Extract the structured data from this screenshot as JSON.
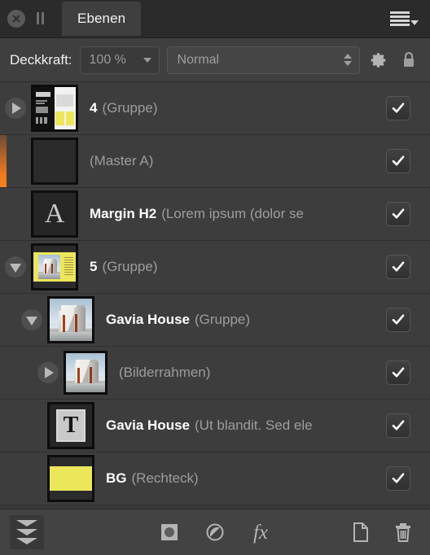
{
  "window": {
    "tab_label": "Ebenen",
    "close_icon": "close-circle-icon",
    "grip_icon": "pause-grip-icon",
    "panel_menu_icon": "hamburger-menu-icon"
  },
  "options": {
    "opacity_label": "Deckkraft:",
    "opacity_value": "100 %",
    "blend_mode_value": "Normal",
    "blend_mode_placeholder": "Normal",
    "settings_icon": "gear-icon",
    "lock_icon": "lock-icon"
  },
  "layers": [
    {
      "name": "4",
      "type": "(Gruppe)",
      "indent": 0,
      "twisty": "collapsed",
      "thumb": "spread",
      "visible": true,
      "master_marker": false
    },
    {
      "name": "",
      "type": "(Master A)",
      "indent": 0,
      "twisty": "none",
      "thumb": "dark",
      "visible": true,
      "master_marker": true
    },
    {
      "name": "Margin H2",
      "type": "(Lorem ipsum (dolor se",
      "indent": 0,
      "twisty": "none",
      "thumb": "glyph-A",
      "visible": true,
      "master_marker": false
    },
    {
      "name": "5",
      "type": "(Gruppe)",
      "indent": 0,
      "twisty": "expanded",
      "thumb": "yellow-page",
      "visible": true,
      "master_marker": false
    },
    {
      "name": "Gavia House",
      "type": "(Gruppe)",
      "indent": 1,
      "twisty": "expanded",
      "thumb": "building",
      "visible": true,
      "master_marker": false
    },
    {
      "name": "",
      "type": "(Bilderrahmen)",
      "indent": 2,
      "twisty": "collapsed",
      "thumb": "building",
      "visible": true,
      "master_marker": false
    },
    {
      "name": "Gavia House",
      "type": "(Ut blandit. Sed ele",
      "indent": 1,
      "twisty": "none",
      "thumb": "glyph-T",
      "visible": true,
      "master_marker": false
    },
    {
      "name": "BG",
      "type": "(Rechteck)",
      "indent": 1,
      "twisty": "none",
      "thumb": "rect-yellow",
      "visible": true,
      "master_marker": false
    }
  ],
  "bottom_toolbar": {
    "layers_icon": "layers-stack-icon",
    "mask_icon": "mask-icon",
    "adjustment_icon": "adjustment-icon",
    "fx_label": "fx",
    "new_layer_icon": "new-layer-icon",
    "delete_icon": "trash-icon"
  },
  "colors": {
    "accent_orange": "#f4821f",
    "panel_bg": "#3d3d3d",
    "tab_active": "#3f3f3f",
    "highlight_yellow": "#ece65a"
  }
}
